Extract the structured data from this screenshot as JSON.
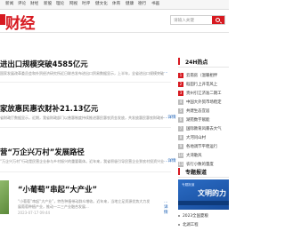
{
  "nav": {
    "items": [
      "新闻",
      "评论",
      "财经",
      "新股",
      "理论",
      "网视",
      "时评",
      "健文化",
      "体育",
      "健康",
      "德行",
      "书画"
    ]
  },
  "logo": {
    "text": "财经",
    "brand_color": "#d71920"
  },
  "search": {
    "placeholder": "请输入关键"
  },
  "articles": [
    {
      "title": "进出口规模突破4585亿元",
      "meta": "国家发展改革委员会和外贸经济研究所近日联合发布进出口贸易数据显示，上半年，全省进出口规模突破4585亿元，同比增长，显示出外贸发展的韧性...",
      "more": "..."
    },
    {
      "title": "家放惠民惠农财补21.13亿元",
      "meta": "省财政厅数据显示，近期，我省财政部门以普惠制度持续推进惠民惠农资金发放，共发放惠民惠农财政补贴资金21.13亿元，覆盖全省各市县...",
      "more": "...详情"
    },
    {
      "title": "营“万企兴万村”发展路径",
      "meta": "“万企兴万村”行动是民营企业参与乡村振兴的重要载体。近年来，我省积极引导民营企业到农村投资兴业，探索出一条富有特色的发展路径...",
      "more": "...详情"
    }
  ],
  "feature": {
    "title": "“小葡萄”串起“大产业”",
    "meta": "“小葡萄”串起“大产业”，特色种植带动群众增收。近年来，当地立足资源优势大力发展葡萄种植产业，推动一二三产业融合发展...",
    "time": "2023-07-17 09:44",
    "more": "...详情"
  },
  "hot": {
    "title": "24H热点",
    "items": [
      "云南房（温暖相伴",
      "稻田行上开花风上",
      "贵州引江济准二期工",
      "中国大外贸市场稳定",
      "共建生态宜居",
      "湖苑数字赋能",
      "国际教育风暴去大气",
      "大河问山村",
      "各地调节平稳运行",
      "大湾歌风",
      "农行小数的量度"
    ]
  },
  "special": {
    "title": "专题报道",
    "banner_text": "文明的力",
    "banner_sub": "专题报道",
    "items": [
      "2023全国夏粮",
      "北湖工程"
    ]
  }
}
